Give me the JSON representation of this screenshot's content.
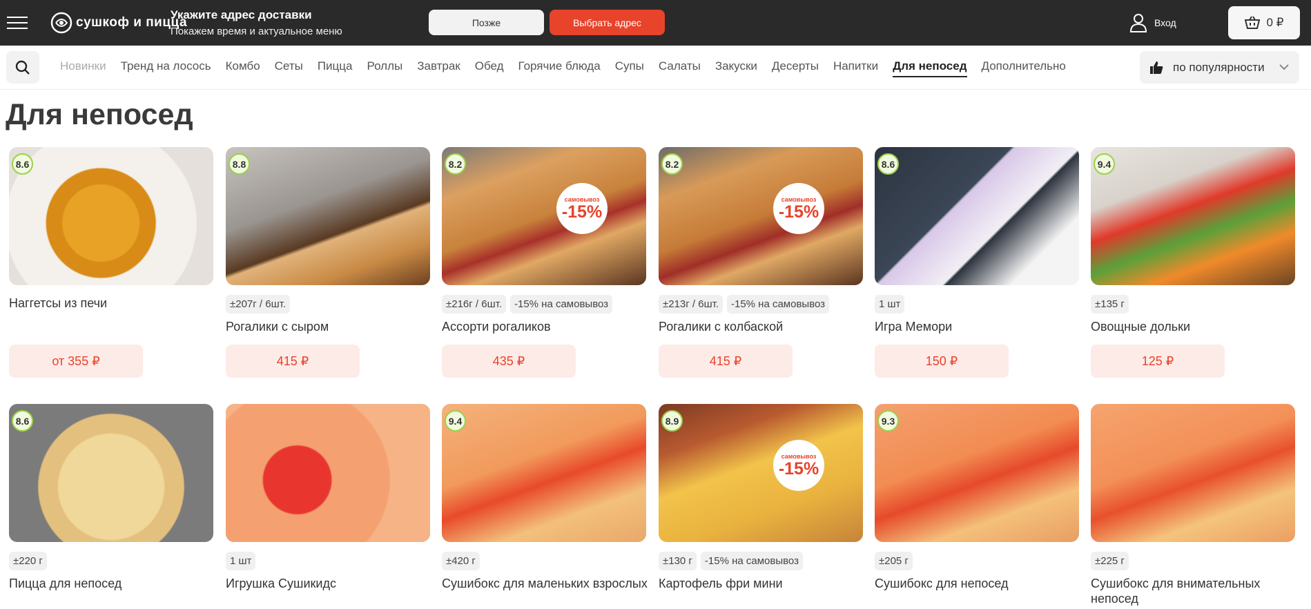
{
  "header": {
    "logo_text": "сушкоф и пицца",
    "address_title": "Укажите адрес доставки",
    "address_subtitle": "Покажем время и актуальное меню",
    "later_label": "Позже",
    "choose_address_label": "Выбрать адрес",
    "login_label": "Вход",
    "cart_total": "0 ₽"
  },
  "nav": {
    "categories": [
      "Новинки",
      "Тренд на лосось",
      "Комбо",
      "Сеты",
      "Пицца",
      "Роллы",
      "Завтрак",
      "Обед",
      "Горячие блюда",
      "Супы",
      "Салаты",
      "Закуски",
      "Десерты",
      "Напитки",
      "Для непосед",
      "Дополнительно"
    ],
    "active_category": "Для непосед",
    "sort_label": "по популярности"
  },
  "page_title": "Для непосед",
  "products": [
    {
      "name": "Наггетсы из печи",
      "rating": "8.6",
      "tags": [],
      "price": "от 355 ₽",
      "promo": null
    },
    {
      "name": "Рогалики с сыром",
      "rating": "8.8",
      "tags": [
        "±207г / 6шт."
      ],
      "price": "415 ₽",
      "promo": null
    },
    {
      "name": "Ассорти рогаликов",
      "rating": "8.2",
      "tags": [
        "±216г / 6шт.",
        "-15% на самовывоз"
      ],
      "price": "435 ₽",
      "promo": {
        "top": "самовывоз",
        "value": "-15%"
      }
    },
    {
      "name": "Рогалики с колбаской",
      "rating": "8.2",
      "tags": [
        "±213г / 6шт.",
        "-15% на самовывоз"
      ],
      "price": "415 ₽",
      "promo": {
        "top": "самовывоз",
        "value": "-15%"
      }
    },
    {
      "name": "Игра Мемори",
      "rating": "8.6",
      "tags": [
        "1 шт"
      ],
      "price": "150 ₽",
      "promo": null
    },
    {
      "name": "Овощные дольки",
      "rating": "9.4",
      "tags": [
        "±135 г"
      ],
      "price": "125 ₽",
      "promo": null
    },
    {
      "name": "Пицца для непосед",
      "rating": "8.6",
      "tags": [
        "±220 г"
      ],
      "price": null,
      "promo": null
    },
    {
      "name": "Игрушка Сушикидс",
      "rating": null,
      "tags": [
        "1 шт"
      ],
      "price": null,
      "promo": null
    },
    {
      "name": "Сушибокс для маленьких взрослых",
      "rating": "9.4",
      "tags": [
        "±420 г"
      ],
      "price": null,
      "promo": null
    },
    {
      "name": "Картофель фри мини",
      "rating": "8.9",
      "tags": [
        "±130 г",
        "-15% на самовывоз"
      ],
      "price": null,
      "promo": {
        "top": "самовывоз",
        "value": "-15%"
      }
    },
    {
      "name": "Сушибокс для непосед",
      "rating": "9.3",
      "tags": [
        "±205 г"
      ],
      "price": null,
      "promo": null
    },
    {
      "name": "Сушибокс для внимательных непосед",
      "rating": null,
      "tags": [
        "±225 г"
      ],
      "price": null,
      "promo": null
    }
  ],
  "colors": {
    "accent": "#e8432b",
    "header_bg": "#2a2a2a",
    "rating_border": "#9bd14b",
    "price_bg": "#fdebe7"
  },
  "icons": [
    "menu-icon",
    "user-icon",
    "cart-icon",
    "search-icon",
    "thumbs-up-icon",
    "chevron-down-icon"
  ]
}
